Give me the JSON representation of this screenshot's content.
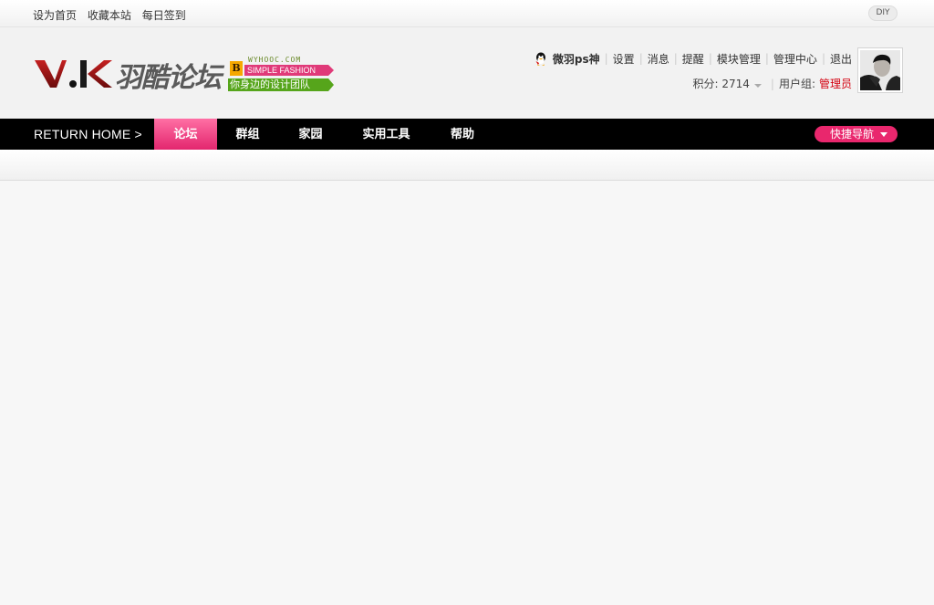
{
  "topbar": {
    "links": [
      "设为首页",
      "收藏本站",
      "每日签到"
    ],
    "diy_label": "DIY"
  },
  "logo": {
    "mark_text": "V.K",
    "cn_text": "羽酷论坛",
    "badge_letter": "B",
    "domain_text": "WYHOOC.COM",
    "simple_text": "SIMPLE FASHION",
    "slogan_text": "你身边的设计团队"
  },
  "user": {
    "name": "微羽ps神",
    "menu": [
      "设置",
      "消息",
      "提醒",
      "模块管理",
      "管理中心",
      "退出"
    ],
    "points_label": "积分: 2714",
    "group_label": "用户组:",
    "group_value": "管理员",
    "qq_icon": "qq-penguin-icon"
  },
  "nav": {
    "home_label": "RETURN HOME  >",
    "items": [
      "论坛",
      "群组",
      "家园",
      "实用工具",
      "帮助"
    ],
    "active_index": 0,
    "quick_label": "快捷导航"
  },
  "colors": {
    "accent_pink": "#e9276d",
    "nav_bg": "#000000",
    "group_red": "#d3000f",
    "slogan_green": "#56a51b"
  }
}
